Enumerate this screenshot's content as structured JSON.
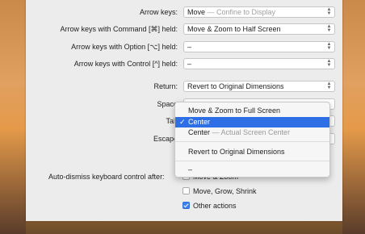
{
  "rows": [
    {
      "label": "Arrow keys:",
      "value": "Move",
      "hint": " — Confine to Display"
    },
    {
      "label": "Arrow keys with Command [⌘] held:",
      "value": "Move & Zoom to Half Screen",
      "hint": ""
    },
    {
      "label": "Arrow keys with Option [⌥] held:",
      "value": "–",
      "hint": ""
    },
    {
      "label": "Arrow keys with Control [^] held:",
      "value": "–",
      "hint": ""
    },
    {
      "label": "Return:",
      "value": "Revert to Original Dimensions",
      "hint": ""
    },
    {
      "label": "Space",
      "value": "",
      "hint": ""
    },
    {
      "label": "Tab",
      "value": "",
      "hint": ""
    },
    {
      "label": "Escape",
      "value": "",
      "hint": ""
    }
  ],
  "menu": {
    "items": [
      {
        "label": "Move & Zoom to Full Screen",
        "hint": ""
      },
      {
        "label": "Center",
        "hint": "",
        "selected": true,
        "check": "✓"
      },
      {
        "label": "Center",
        "hint": " — Actual Screen Center"
      },
      {
        "label": "Revert to Original Dimensions",
        "hint": ""
      },
      {
        "label": "–",
        "hint": ""
      }
    ]
  },
  "auto_dismiss": {
    "label": "Auto-dismiss keyboard control after:",
    "options": [
      {
        "label": "Move & Zoom",
        "checked": false
      },
      {
        "label": "Move, Grow, Shrink",
        "checked": false
      },
      {
        "label": "Other actions",
        "checked": true
      }
    ]
  },
  "icons": {
    "popup_arrows": "updown-chevron-icon",
    "checkmark": "checkmark-icon"
  },
  "colors": {
    "selection": "#2f6fe6",
    "checkbox_checked": "#3b82f0",
    "panel": "#ececec"
  }
}
